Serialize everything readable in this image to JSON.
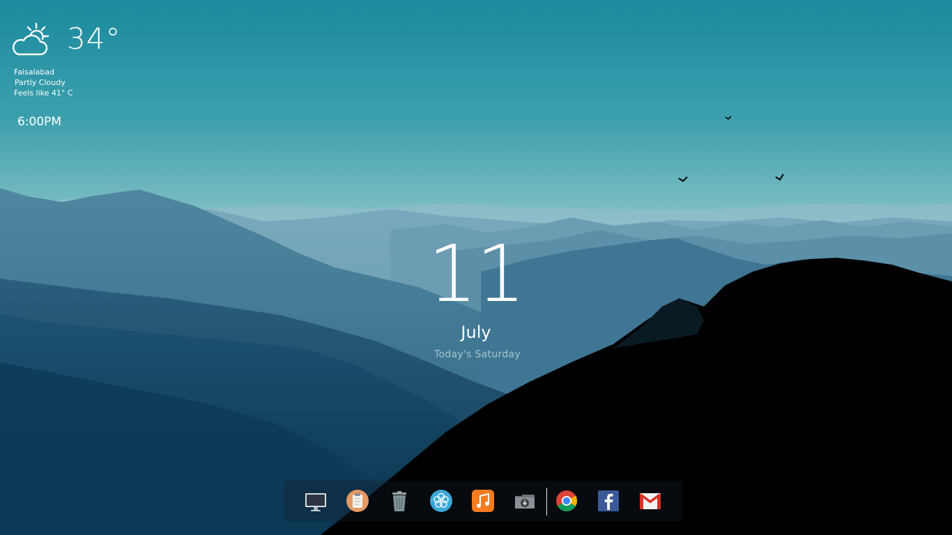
{
  "weather": {
    "icon": "partly-cloudy-icon",
    "temperature": "34°",
    "location": "Faisalabad",
    "condition": "Partly Cloudy",
    "feels_like": "Feels like 41° C"
  },
  "clock": {
    "time": "6:00PM"
  },
  "date": {
    "day": "11",
    "month": "July",
    "weekday_text": "Today's Saturday"
  },
  "dock": {
    "items": [
      {
        "icon": "monitor-icon"
      },
      {
        "icon": "notes-icon"
      },
      {
        "icon": "trash-icon"
      },
      {
        "icon": "settings-flower-icon"
      },
      {
        "icon": "music-icon"
      },
      {
        "icon": "downloads-icon"
      },
      {
        "icon": "chrome-icon"
      },
      {
        "icon": "facebook-icon"
      },
      {
        "icon": "gmail-icon"
      }
    ]
  },
  "colors": {
    "sky_top": "#1a8a9e",
    "sky_bottom": "#8fc4c8",
    "mountain_far": "#6d9fb4",
    "mountain_mid": "#3b7290",
    "mountain_near": "#1f4f6c",
    "forest": "#000000",
    "weekday_text": "#a9c5cf"
  }
}
